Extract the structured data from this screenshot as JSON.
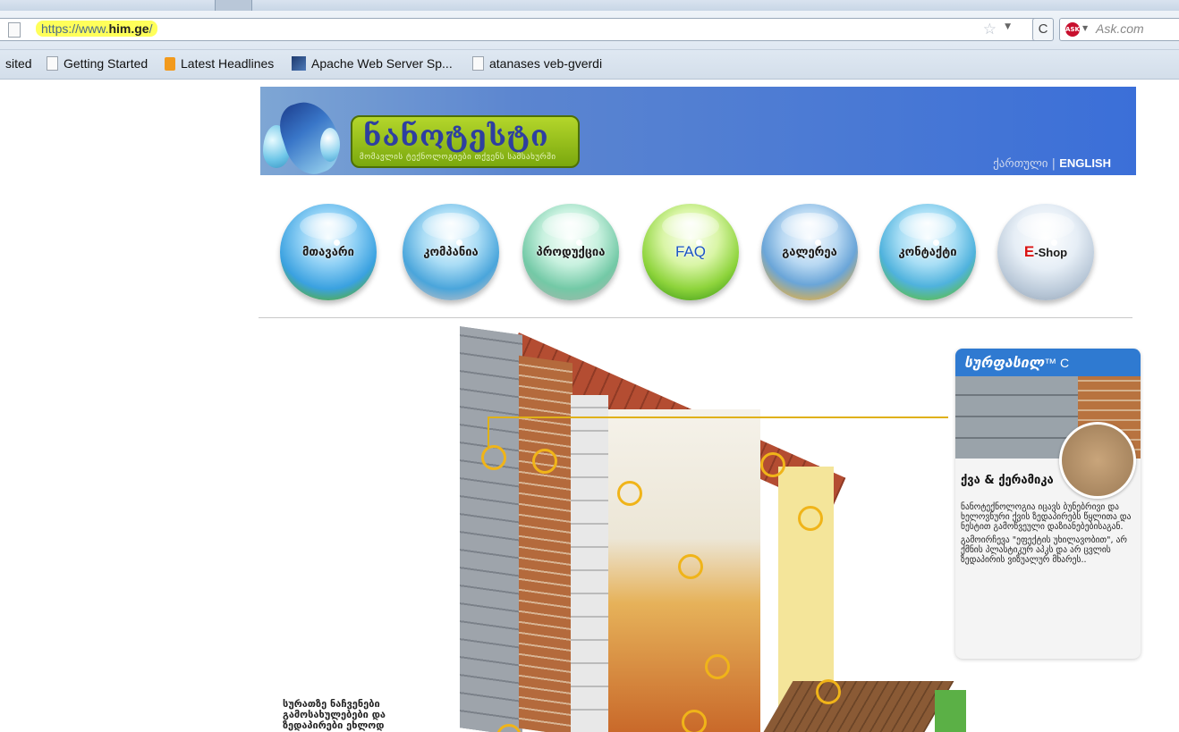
{
  "browser": {
    "url_prefix": "https://www.",
    "url_domain": "him.ge",
    "url_suffix": "/",
    "search_placeholder": "Ask.com",
    "search_engine_logo": "ASK",
    "bookmarks": [
      {
        "label": "sited",
        "icon": "none"
      },
      {
        "label": "Getting Started",
        "icon": "page-icon"
      },
      {
        "label": "Latest Headlines",
        "icon": "rss-icon"
      },
      {
        "label": "Apache Web Server Sp...",
        "icon": "apache-icon"
      },
      {
        "label": "atanases veb-gverdi",
        "icon": "page-icon"
      }
    ]
  },
  "site": {
    "logo_text": "ნანოტესტი",
    "logo_tagline": "მომავლის ტექნოლოგიები თქვენს სამსახურში",
    "lang_ka": "ქართული",
    "lang_sep": "|",
    "lang_en": "ENGLISH",
    "nav": [
      {
        "label": "მთავარი"
      },
      {
        "label": "კომპანია"
      },
      {
        "label": "პროდუქცია"
      },
      {
        "label": "FAQ"
      },
      {
        "label": "გალერეა"
      },
      {
        "label": "კონტაქტი"
      },
      {
        "label_e": "E",
        "label_rest": "-Shop"
      }
    ],
    "bottom_text": "სურათზე ნაჩვენები გამოსახულებები და ზედაპირები ეხლოდ",
    "card": {
      "title": "სურფასილ",
      "title_tm": "™ C",
      "subtitle": "ქვა & ქერამიკა",
      "p1": "ნანოტექნოლოგია იცავს ბუნებრივი და ხელოვნური ქვის ზედაპირებს წყლითა და ნესტით გამოწვეული დაზიანებებისაგან.",
      "p2": "გამოირჩევა \"ეფექტის უხილავობით\", არ ქმნის პლასტიკურ აპკს და არ ცვლის ზედაპირის ვიზუალურ მხარეს.."
    }
  },
  "colors": {
    "banner_blue": "#3b6fd8",
    "logo_green": "#9cc41a",
    "card_header": "#2f7ad1",
    "ring": "#f0b419"
  }
}
